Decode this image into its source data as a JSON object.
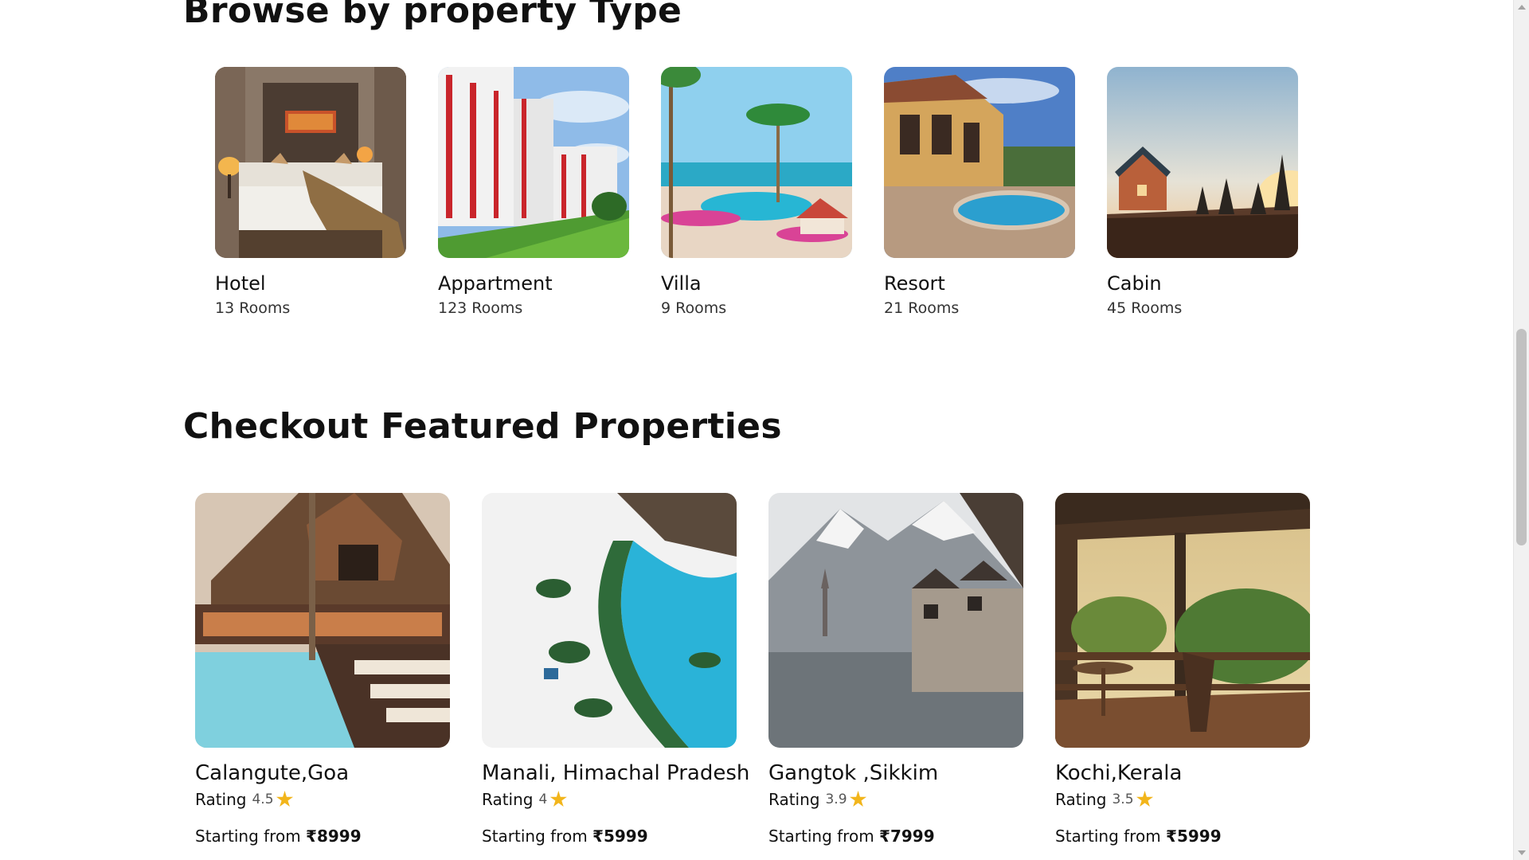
{
  "browse": {
    "title": "Browse by property Type",
    "types": [
      {
        "name": "Hotel",
        "rooms": "13 Rooms"
      },
      {
        "name": "Appartment",
        "rooms": "123 Rooms"
      },
      {
        "name": "Villa",
        "rooms": "9 Rooms"
      },
      {
        "name": "Resort",
        "rooms": "21 Rooms"
      },
      {
        "name": "Cabin",
        "rooms": "45 Rooms"
      }
    ]
  },
  "featured": {
    "title": "Checkout Featured Properties",
    "rating_label": "Rating",
    "price_prefix": "Starting from",
    "properties": [
      {
        "location": "Calangute,Goa",
        "rating": "4.5",
        "price": "₹8999"
      },
      {
        "location": "Manali, Himachal Pradesh",
        "rating": "4",
        "price": "₹5999"
      },
      {
        "location": "Gangtok ,Sikkim",
        "rating": "3.9",
        "price": "₹7999"
      },
      {
        "location": "Kochi,Kerala",
        "rating": "3.5",
        "price": "₹5999"
      }
    ]
  },
  "colors": {
    "star": "#f2b51b",
    "text": "#111111",
    "background": "#ffffff"
  },
  "icons": {
    "rating": "star-icon"
  }
}
